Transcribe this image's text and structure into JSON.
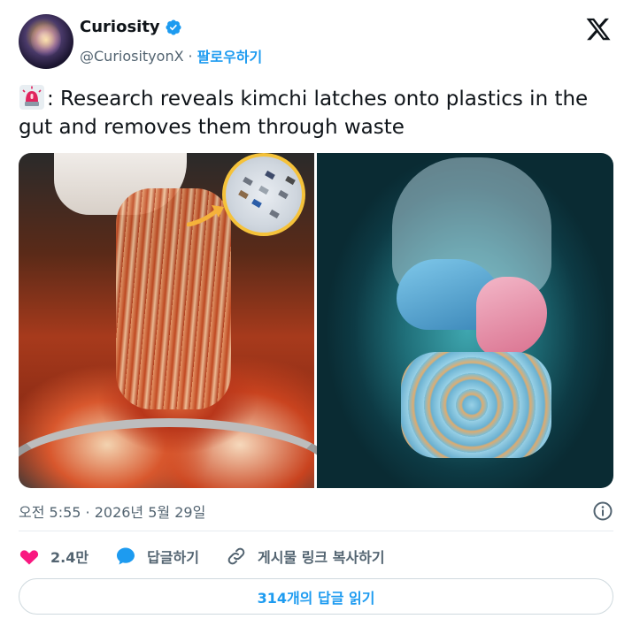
{
  "author": {
    "name": "Curiosity",
    "handle": "@CuriosityonX",
    "separator": "·",
    "follow_label": "팔로우하기",
    "verified": true
  },
  "tweet": {
    "text": ": Research reveals kimchi latches onto plastics in the gut and removes them through waste",
    "emoji": "police-car-light-icon"
  },
  "media": {
    "images": [
      {
        "name": "kimchi-photo"
      },
      {
        "name": "anatomy-illustration"
      }
    ]
  },
  "timestamp": "오전 5:55 · 2026년 5월 29일",
  "actions": {
    "likes": "2.4만",
    "reply_label": "답글하기",
    "copy_link_label": "게시물 링크 복사하기"
  },
  "read_replies_label": "314개의 답글 읽기",
  "colors": {
    "accent": "#1d9bf0",
    "like": "#f91880",
    "text": "#0f1419",
    "secondary": "#536471"
  },
  "icons": [
    "verified-badge-icon",
    "x-logo-icon",
    "siren-icon",
    "info-icon",
    "heart-icon",
    "reply-bubble-icon",
    "link-icon"
  ]
}
